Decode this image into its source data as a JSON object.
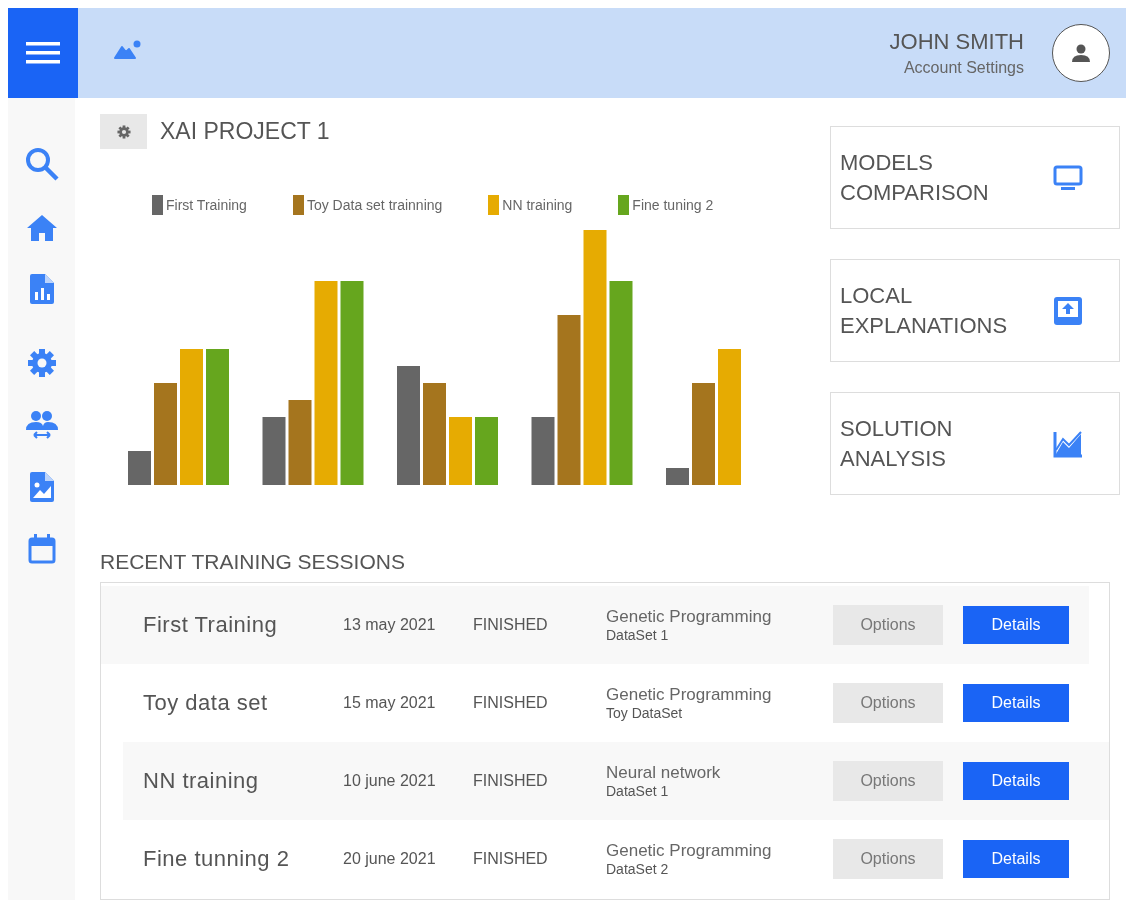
{
  "header": {
    "user_name": "JOHN SMITH",
    "account_link": "Account Settings"
  },
  "project": {
    "title": "XAI PROJECT 1"
  },
  "chart_legend": [
    {
      "label": "First Training",
      "color": "#666666"
    },
    {
      "label": "Toy Data set trainning",
      "color": "#a5751e"
    },
    {
      "label": "NN training",
      "color": "#e6ab02"
    },
    {
      "label": "Fine tuning 2",
      "color": "#66a61e"
    }
  ],
  "action_cards": [
    {
      "title": "MODELS COMPARISON"
    },
    {
      "title": "LOCAL EXPLANATIONS"
    },
    {
      "title": "SOLUTION ANALYSIS"
    }
  ],
  "sessions": {
    "title": "RECENT TRAINING SESSIONS",
    "rows": [
      {
        "name": "First Training",
        "date": "13 may 2021",
        "status": "FINISHED",
        "method": "Genetic Programming",
        "dataset": "DataSet 1",
        "options": "Options",
        "details": "Details"
      },
      {
        "name": "Toy data set",
        "date": "15 may 2021",
        "status": "FINISHED",
        "method": "Genetic Programming",
        "dataset": "Toy DataSet",
        "options": "Options",
        "details": "Details"
      },
      {
        "name": "NN training",
        "date": "10 june 2021",
        "status": "FINISHED",
        "method": "Neural network",
        "dataset": "DataSet 1",
        "options": "Options",
        "details": "Details"
      },
      {
        "name": "Fine tunning 2",
        "date": "20 june 2021",
        "status": "FINISHED",
        "method": "Genetic Programming",
        "dataset": "DataSet 2",
        "options": "Options",
        "details": "Details"
      }
    ]
  }
}
